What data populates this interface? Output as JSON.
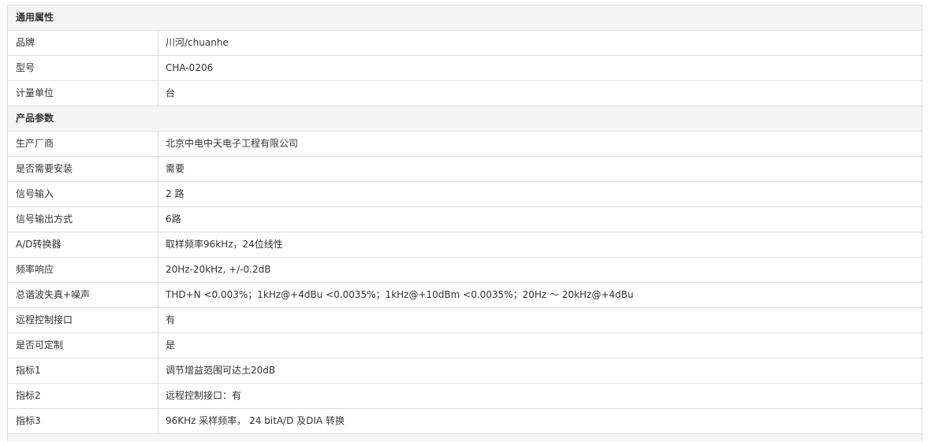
{
  "groups": [
    {
      "title": "通用属性",
      "rows": [
        {
          "label": "品牌",
          "value": "川河/chuanhe"
        },
        {
          "label": "型号",
          "value": "CHA-0206"
        },
        {
          "label": "计量单位",
          "value": "台"
        }
      ]
    },
    {
      "title": "产品参数",
      "rows": [
        {
          "label": "生产厂商",
          "value": "北京中电中天电子工程有限公司"
        },
        {
          "label": "是否需要安装",
          "value": "需要"
        },
        {
          "label": "信号输入",
          "value": "2 路"
        },
        {
          "label": "信号输出方式",
          "value": "6路"
        },
        {
          "label": "A/D转换器",
          "value": "取样频率96kHz，24位线性"
        },
        {
          "label": "频率响应",
          "value": "20Hz-20kHz, +/-0.2dB"
        },
        {
          "label": "总谐波失真+噪声",
          "value": "THD+N <0.003%；1kHz@+4dBu <0.0035%；1kHz@+10dBm <0.0035%；20Hz ～ 20kHz@+4dBu"
        },
        {
          "label": "远程控制接口",
          "value": "有"
        },
        {
          "label": "是否可定制",
          "value": "是"
        },
        {
          "label": "指标1",
          "value": "调节增益范围可达土20dB"
        },
        {
          "label": "指标2",
          "value": "远程控制接口：有"
        },
        {
          "label": "指标3",
          "value": "96KHz 采样频率， 24 bitA/D 及DIA 转换"
        }
      ]
    }
  ]
}
